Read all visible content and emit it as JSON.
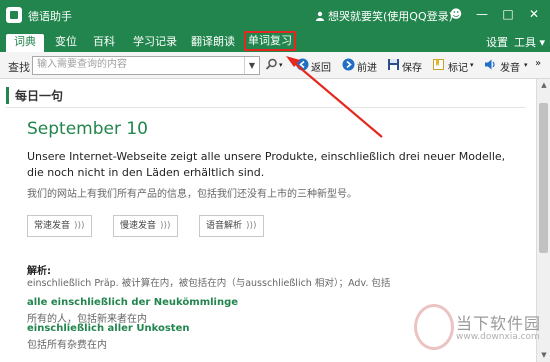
{
  "window": {
    "title": "德语助手",
    "user": "想哭就要笑(使用QQ登录)",
    "controls": [
      "☻",
      "—",
      "□",
      "✕"
    ]
  },
  "nav": {
    "tabs": [
      "词典",
      "变位",
      "百科",
      "学习记录",
      "翻译朗读",
      "单词复习"
    ],
    "active": "词典",
    "highlighted": "单词复习",
    "settings": "设置",
    "tools": "工具 ▾"
  },
  "toolbar": {
    "search_label": "查找",
    "search_placeholder": "输入需要查询的内容",
    "back": "返回",
    "forward": "前进",
    "save": "保存",
    "mark": "标记",
    "speak": "发音"
  },
  "daily": {
    "section_title": "每日一句",
    "date": "September 10",
    "sentence_de": "Unsere Internet-Webseite zeigt alle unsere Produkte, einschließlich drei neuer Modelle, die noch nicht in den Läden erhältlich sind.",
    "sentence_zh": "我们的网站上有我们所有产品的信息，包括我们还没有上市的三种新型号。",
    "buttons": [
      "常速发音",
      "慢速发音",
      "语音解析"
    ],
    "parse_title": "解析:",
    "parse_line": "einschließlich Präp. 被计算在内，被包括在内（与ausschließlich 相对）；Adv. 包括",
    "phrases": [
      {
        "de": "alle einschließlich der Neukömmlinge",
        "zh": "所有的人，包括新来者在内"
      },
      {
        "de": "einschließlich aller Unkosten",
        "zh": "包括所有杂费在内"
      }
    ]
  },
  "watermark": {
    "name": "当下软件园",
    "url": "www.downxia.com"
  },
  "colors": {
    "brand_green": "#21854d",
    "annotation_red": "#e5281f"
  }
}
